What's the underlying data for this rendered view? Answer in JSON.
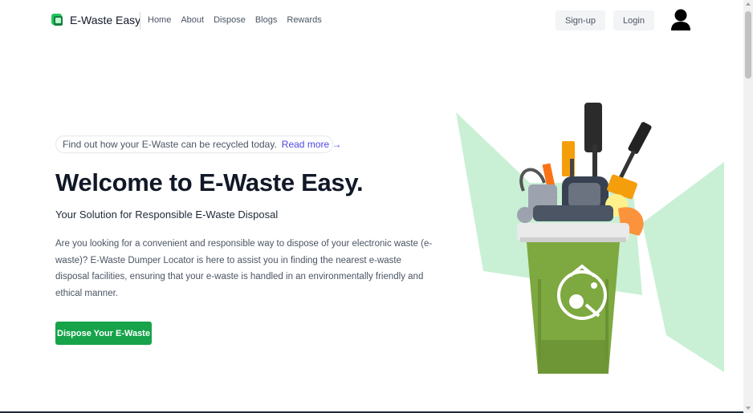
{
  "header": {
    "brand": "E-Waste Easy",
    "nav": [
      "Home",
      "About",
      "Dispose",
      "Blogs",
      "Rewards"
    ],
    "signup_label": "Sign-up",
    "login_label": "Login"
  },
  "hero": {
    "pill_text": "Find out how your E-Waste can be recycled today.",
    "pill_link": "Read more →",
    "title": "Welcome to E-Waste Easy.",
    "subtitle": "Your Solution for Responsible E-Waste Disposal",
    "description": "Are you looking for a convenient and responsible way to dispose of your electronic waste (e-waste)? E-Waste Dumper Locator is here to assist you in finding the nearest e-waste disposal facilities, ensuring that your e-waste is handled in an environmentally friendly and ethical manner.",
    "cta_label": "Dispose Your E-Waste"
  },
  "colors": {
    "brand_green": "#16a34a",
    "link": "#4f46e5",
    "bin_green": "#7ea840",
    "shape_green": "#c9f0d4"
  },
  "icons": [
    "logo-icon",
    "user-avatar-icon",
    "ewaste-bin-image"
  ]
}
